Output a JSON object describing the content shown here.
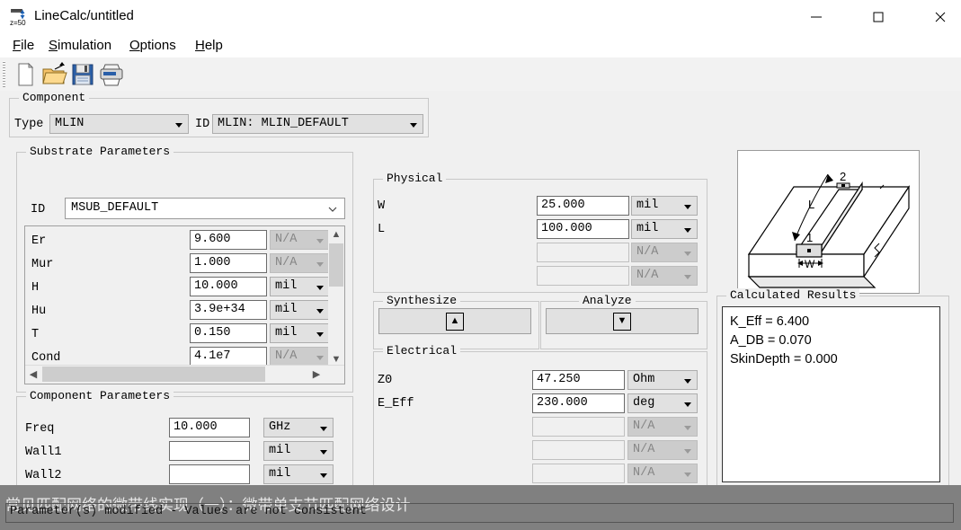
{
  "window": {
    "title": "LineCalc/untitled",
    "icon": "linecalc-z50-icon",
    "controls": {
      "minimize": "—",
      "maximize": "☐",
      "close": "✕"
    }
  },
  "menubar": {
    "items": [
      {
        "label": "File",
        "mnemonic": "F"
      },
      {
        "label": "Simulation",
        "mnemonic": "S"
      },
      {
        "label": "Options",
        "mnemonic": "O"
      },
      {
        "label": "Help",
        "mnemonic": "H"
      }
    ]
  },
  "toolbar": {
    "buttons": [
      {
        "name": "new-file-icon",
        "tip": "New"
      },
      {
        "name": "open-folder-icon",
        "tip": "Open"
      },
      {
        "name": "save-floppy-icon",
        "tip": "Save"
      },
      {
        "name": "print-icon",
        "tip": "Print"
      }
    ]
  },
  "component": {
    "group_title": "Component",
    "type_label": "Type",
    "type_value": "MLIN",
    "id_label": "ID",
    "id_value": "MLIN: MLIN_DEFAULT"
  },
  "substrate": {
    "group_title": "Substrate Parameters",
    "id_label": "ID",
    "id_value": "MSUB_DEFAULT",
    "rows": [
      {
        "name": "Er",
        "value": "9.600",
        "unit": "N/A",
        "unit_enabled": false
      },
      {
        "name": "Mur",
        "value": "1.000",
        "unit": "N/A",
        "unit_enabled": false
      },
      {
        "name": "H",
        "value": "10.000",
        "unit": "mil",
        "unit_enabled": true
      },
      {
        "name": "Hu",
        "value": "3.9e+34",
        "unit": "mil",
        "unit_enabled": true
      },
      {
        "name": "T",
        "value": "0.150",
        "unit": "mil",
        "unit_enabled": true
      },
      {
        "name": "Cond",
        "value": "4.1e7",
        "unit": "N/A",
        "unit_enabled": false
      }
    ]
  },
  "component_parameters": {
    "group_title": "Component Parameters",
    "rows": [
      {
        "name": "Freq",
        "value": "10.000",
        "unit": "GHz",
        "unit_enabled": true
      },
      {
        "name": "Wall1",
        "value": "",
        "unit": "mil",
        "unit_enabled": true
      },
      {
        "name": "Wall2",
        "value": "",
        "unit": "mil",
        "unit_enabled": true
      }
    ]
  },
  "physical": {
    "group_title": "Physical",
    "rows": [
      {
        "name": "W",
        "value": "25.000",
        "unit": "mil",
        "enabled": true
      },
      {
        "name": "L",
        "value": "100.000",
        "unit": "mil",
        "enabled": true
      },
      {
        "name": "",
        "value": "",
        "unit": "N/A",
        "enabled": false
      },
      {
        "name": "",
        "value": "",
        "unit": "N/A",
        "enabled": false
      }
    ]
  },
  "synthesize": {
    "group_title": "Synthesize",
    "button_glyph": "▲",
    "button_name": "synthesize-up-arrow-button"
  },
  "analyze": {
    "group_title": "Analyze",
    "button_glyph": "▼",
    "button_name": "analyze-down-arrow-button"
  },
  "electrical": {
    "group_title": "Electrical",
    "rows": [
      {
        "name": "Z0",
        "value": "47.250",
        "unit": "Ohm",
        "enabled": true
      },
      {
        "name": "E_Eff",
        "value": "230.000",
        "unit": "deg",
        "enabled": true
      },
      {
        "name": "",
        "value": "",
        "unit": "N/A",
        "enabled": false
      },
      {
        "name": "",
        "value": "",
        "unit": "N/A",
        "enabled": false
      },
      {
        "name": "",
        "value": "",
        "unit": "N/A",
        "enabled": false
      }
    ]
  },
  "calculated_results": {
    "group_title": "Calculated Results",
    "lines": [
      "K_Eff = 6.400",
      "A_DB = 0.070",
      "SkinDepth = 0.000"
    ]
  },
  "diagram": {
    "name": "microstrip-line-3d-diagram",
    "labels": {
      "length": "L",
      "width": "W",
      "port1": "1",
      "port2": "2"
    }
  },
  "statusbar": {
    "message": "Parameter(s) modified - Values are not consistent"
  },
  "watermark": {
    "text": "常见匹配网络的微带线实现（一）：微带单支节匹配网络设计"
  },
  "colors": {
    "dialog_bg": "#f0f0f0",
    "field_bg": "#ffffff",
    "combo_bg": "#e1e1e1",
    "disabled_bg": "#cccccc",
    "overlay": "#808080"
  }
}
